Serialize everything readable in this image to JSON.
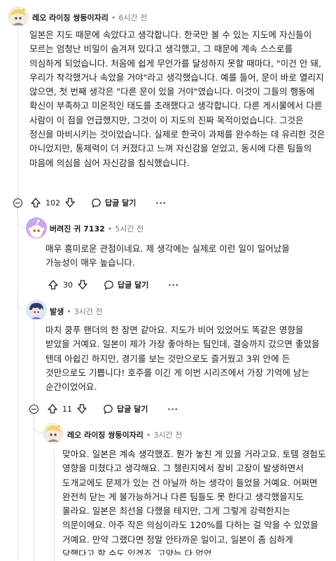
{
  "comments": [
    {
      "author": "레오 라이징 쌍둥이자리",
      "time": "6시간 전",
      "body": "일본은 지도 때문에 속았다고 생각합니다. 한국만 볼 수 있는 지도에 자신들이 모르는 엄청난 비밀이 숨겨져 있다고 생각했고, 그 때문에 계속 스스로를 의심하게 되었습니다. 처음에 쉽게 무언가를 달성하지 못할 때마다, \"이건 안 돼, 우리가 착각했거나 속았을 거야\"라고 생각했습니다. 예를 들어, 문이 바로 열리지 않으면, 첫 번째 생각은 \"다른 문이 있을 거야\"였습니다. 이것이 그들의 행동에 확신이 부족하고 미온적인 태도를 초래했다고 생각합니다. 다른 게시물에서 다른 사람이 이 점을 언급했지만, 그것이 이 지도의 진짜 목적이었습니다. 그것은 정신을 마비시키는 것이었습니다. 실제로 한국이 과제를 완수하는 데 유리한 것은 아니었지만, 통제력이 더 커졌다고 느껴 자신감을 얻었고, 동시에 다른 팀들의 마음에 의심을 심어 자신감을 침식했습니다.",
      "votes": "102",
      "reply_label": "답글 달기",
      "more": "···"
    },
    {
      "author": "버려진 귀 7132",
      "time": "5시간 전",
      "body": "매우 흥미로운 관점이네요. 제 생각에는 실제로 이런 일이 일어났을 가능성이 매우 높습니다.",
      "votes": "30",
      "reply_label": "답글 달기",
      "more": "···"
    },
    {
      "author": "발생",
      "time": "3시간 전",
      "body": "마치 쿵푸 팬더의 한 장면 같아요. 지도가 비어 있었어도 똑같은 영향을 받았을 거예요. 일본이 제가 가장 좋아하는 팀인데, 결승까지 갔으면 좋았을 텐데 아쉽긴 하지만, 경기를 보는 것만으로도 즐거웠고 3위 안에 든 것만으로도 기쁩니다! 호주를 이긴 게 이번 시리즈에서 가장 기억에 남는 순간이었어요.",
      "votes": "11",
      "reply_label": "답글 달기",
      "more": "···"
    },
    {
      "author": "레오 라이징 쌍둥이자리",
      "time": "3시간 전",
      "body": "맞아요. 일본은 계속 생각했죠. 뭔가 놓친 게 있을 거라고요. 토템 경험도 영향을 미쳤다고 생각해요. 그 챌린지에서 장비 고장이 발생하면서 도개교에도 문제가 있는 건 아닐까 하는 생각이 들었을 거예요. 어쩌면 완전히 닫는 게 불가능하거나 다른 팀들도 못 한다고 생각했을지도 몰라요. 일본은 최선을 다했을 테지만, 그게 그렇게 강력한지는 의문이에요. 아주 작은 의심이라도 120%를 다하는 걸 막을 수 있었을 거예요. 만약 그랬다면 정말 안타까운 일이고, 일본이 좀 심하게 당했다고 할 수도 있겠죠. 고양는 다 없었"
    }
  ],
  "colors": {
    "text": "#1c1c1c",
    "meta": "#7c7c7c",
    "thread": "#e0e3e6",
    "avatar_purple": "#c9a6e8",
    "avatar_cream": "#f4eddc"
  },
  "icons": [
    "upvote-icon",
    "downvote-icon",
    "reply-bubble-icon",
    "collapse-icon",
    "more-options-icon"
  ]
}
